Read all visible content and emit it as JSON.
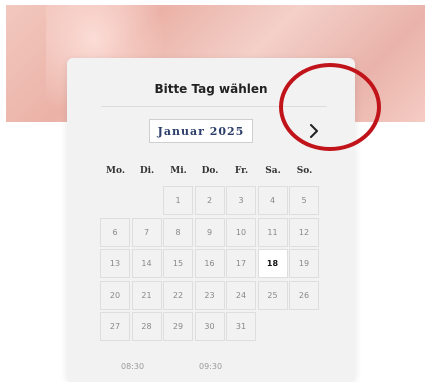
{
  "picker": {
    "title": "Bitte Tag wählen",
    "month_label": "Januar 2025",
    "next_icon": "chevron-right-icon",
    "weekdays": [
      "Mo.",
      "Di.",
      "Mi.",
      "Do.",
      "Fr.",
      "Sa.",
      "So."
    ],
    "weeks": [
      [
        "",
        "",
        "1",
        "2",
        "3",
        "4",
        "5"
      ],
      [
        "6",
        "7",
        "8",
        "9",
        "10",
        "11",
        "12"
      ],
      [
        "13",
        "14",
        "15",
        "16",
        "17",
        "18",
        "19"
      ],
      [
        "20",
        "21",
        "22",
        "23",
        "24",
        "25",
        "26"
      ],
      [
        "27",
        "28",
        "29",
        "30",
        "31",
        "",
        ""
      ]
    ],
    "selected_day": "18",
    "times": [
      "08:30",
      "09:30"
    ]
  },
  "colors": {
    "annotation": "#c0141a",
    "month_text": "#2c3e6a"
  }
}
